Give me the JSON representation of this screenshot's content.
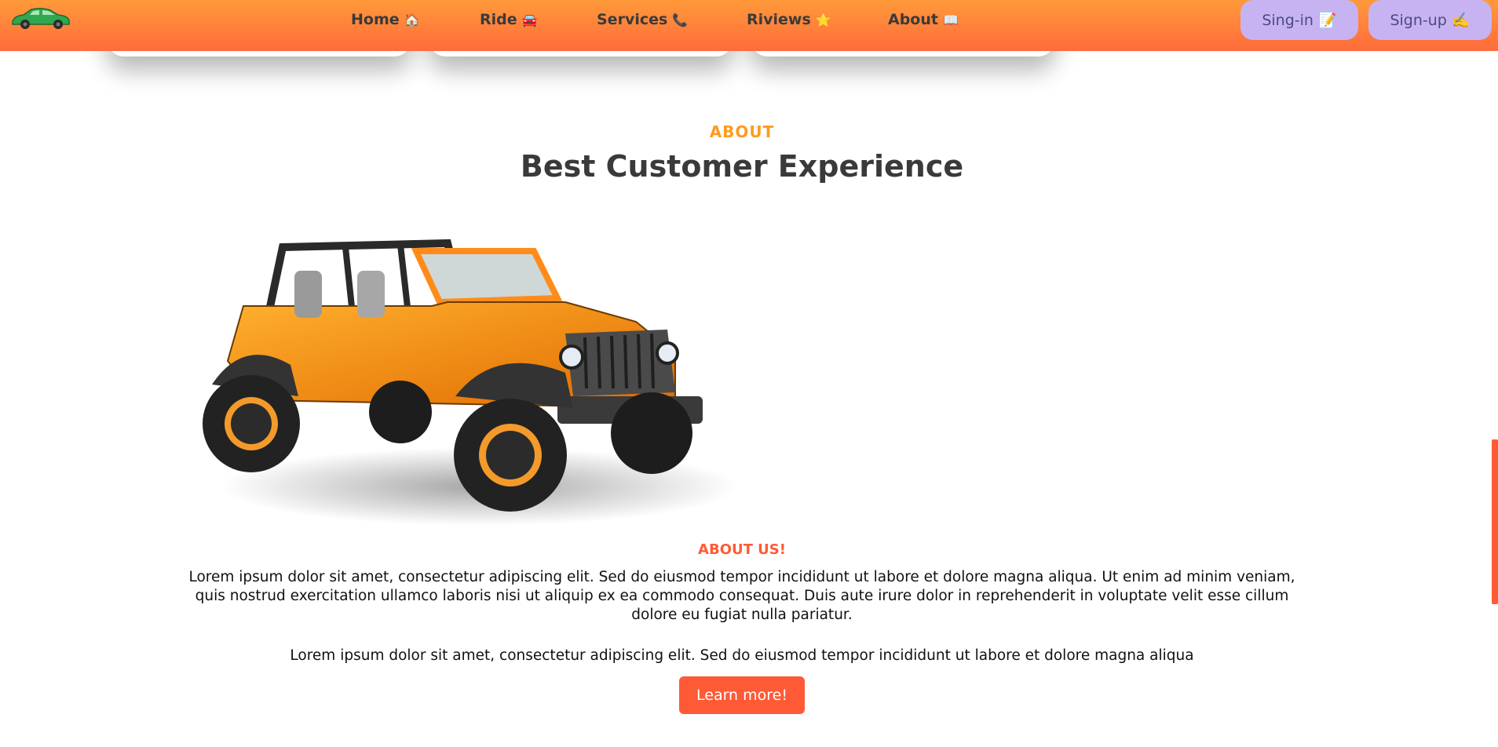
{
  "nav": {
    "links": [
      {
        "label": "Home",
        "emoji": "🏠"
      },
      {
        "label": "Ride",
        "emoji": "🚘"
      },
      {
        "label": "Services",
        "emoji": "📞"
      },
      {
        "label": "Riviews",
        "emoji": "⭐"
      },
      {
        "label": "About",
        "emoji": "📖"
      }
    ],
    "signin_label": "Sing-in 📝",
    "signup_label": "Sign-up ✍️",
    "logo_icon": "car-logo-icon",
    "logo_color": "#2fa84f"
  },
  "about": {
    "eyebrow": "ABOUT",
    "title": "Best Customer Experience",
    "image_icon": "jeep-image",
    "label": "ABOUT US!",
    "paragraph1": "Lorem ipsum dolor sit amet, consectetur adipiscing elit. Sed do eiusmod tempor incididunt ut labore et dolore magna aliqua. Ut enim ad minim veniam, quis nostrud exercitation ullamco laboris nisi ut aliquip ex ea commodo consequat. Duis aute irure dolor in reprehenderit in voluptate velit esse cillum dolore eu fugiat nulla pariatur.",
    "paragraph2": "Lorem ipsum dolor sit amet, consectetur adipiscing elit. Sed do eiusmod tempor incididunt ut labore et dolore magna aliqua",
    "button_label": "Learn more!"
  },
  "colors": {
    "accent": "#ff5a36",
    "eyebrow": "#ff9a1f",
    "auth_button": "#c7b3f2",
    "navbar_gradient": [
      "#ff9a3a",
      "#ff6b3c"
    ]
  }
}
